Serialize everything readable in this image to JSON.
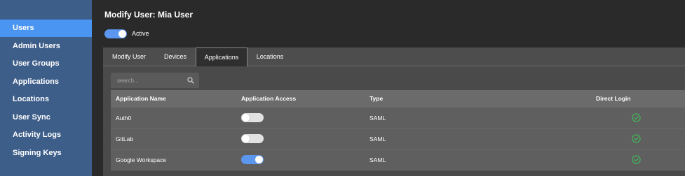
{
  "sidebar": {
    "items": [
      {
        "label": "Users",
        "active": true
      },
      {
        "label": "Admin Users",
        "active": false
      },
      {
        "label": "User Groups",
        "active": false
      },
      {
        "label": "Applications",
        "active": false
      },
      {
        "label": "Locations",
        "active": false
      },
      {
        "label": "User Sync",
        "active": false
      },
      {
        "label": "Activity Logs",
        "active": false
      },
      {
        "label": "Signing Keys",
        "active": false
      }
    ]
  },
  "header": {
    "title": "Modify User: Mia User",
    "active_label": "Active",
    "active_on": true
  },
  "tabs": [
    {
      "label": "Modify User",
      "active": false
    },
    {
      "label": "Devices",
      "active": false
    },
    {
      "label": "Applications",
      "active": true
    },
    {
      "label": "Locations",
      "active": false
    }
  ],
  "search": {
    "placeholder": "search..."
  },
  "table": {
    "columns": [
      "Application Name",
      "Application Access",
      "Type",
      "Direct Login"
    ],
    "rows": [
      {
        "name": "Auth0",
        "access": false,
        "type": "SAML",
        "direct_login": true
      },
      {
        "name": "GitLab",
        "access": false,
        "type": "SAML",
        "direct_login": true
      },
      {
        "name": "Google Workspace",
        "access": true,
        "type": "SAML",
        "direct_login": true
      }
    ]
  },
  "colors": {
    "sidebar_bg": "#3e5e8a",
    "sidebar_active": "#4a95f1",
    "toggle_on": "#5b97ee",
    "check": "#3fbf5a"
  }
}
